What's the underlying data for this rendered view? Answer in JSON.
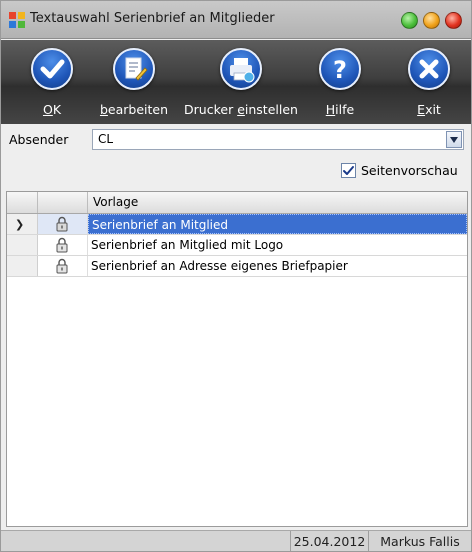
{
  "window": {
    "title": "Textauswahl Serienbrief an Mitglieder",
    "controls": [
      {
        "name": "minimize",
        "color": "#4cbf3b"
      },
      {
        "name": "maximize",
        "color": "#f0a21a"
      },
      {
        "name": "close",
        "color": "#e2321f"
      }
    ]
  },
  "toolbar": {
    "buttons": [
      {
        "id": "ok",
        "prefix": "",
        "accel": "O",
        "suffix": "K",
        "icon": "checkmark-icon"
      },
      {
        "id": "bearbeiten",
        "prefix": "",
        "accel": "b",
        "suffix": "earbeiten",
        "icon": "edit-document-icon"
      },
      {
        "id": "drucker",
        "prefix": "Drucker ",
        "accel": "e",
        "suffix": "instellen",
        "icon": "printer-icon"
      },
      {
        "id": "hilfe",
        "prefix": "",
        "accel": "H",
        "suffix": "ilfe",
        "icon": "question-icon"
      },
      {
        "id": "exit",
        "prefix": "",
        "accel": "E",
        "suffix": "xit",
        "icon": "close-icon"
      }
    ]
  },
  "absender": {
    "label": "Absender",
    "value": "CL"
  },
  "preview": {
    "label": "Seitenvorschau",
    "checked": true
  },
  "grid": {
    "column_header": "Vorlage",
    "selected_index": 0,
    "rows": [
      {
        "vorlage": "Serienbrief an Mitglied"
      },
      {
        "vorlage": "Serienbrief an Mitglied mit Logo"
      },
      {
        "vorlage": "Serienbrief an Adresse eigenes Briefpapier"
      }
    ]
  },
  "status": {
    "date": "25.04.2012",
    "user": "Markus Fallis"
  },
  "colors": {
    "selection": "#3b6fd0",
    "toolbar_icon": "#1f56b8"
  }
}
